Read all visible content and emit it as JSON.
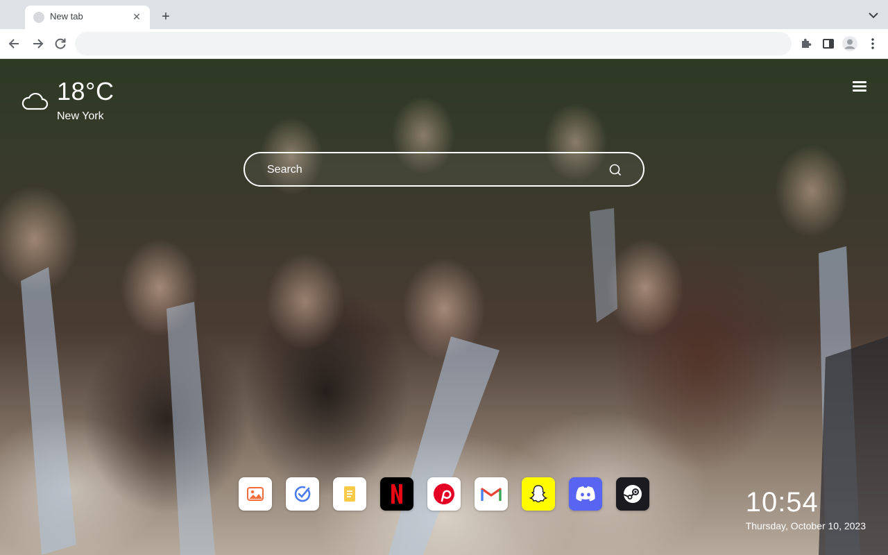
{
  "tab": {
    "title": "New tab"
  },
  "toolbar": {
    "omnibox_value": "",
    "omnibox_placeholder": ""
  },
  "weather": {
    "temperature": "18°C",
    "city": "New York",
    "icon": "cloud-icon"
  },
  "search": {
    "placeholder": "Search"
  },
  "apps": [
    {
      "name": "gallery",
      "icon": "gallery-icon",
      "bg": "#ffffff"
    },
    {
      "name": "todo",
      "icon": "checkmark-icon",
      "bg": "#ffffff"
    },
    {
      "name": "notes",
      "icon": "notes-icon",
      "bg": "#ffffff"
    },
    {
      "name": "netflix",
      "icon": "netflix-icon",
      "bg": "#000000"
    },
    {
      "name": "pinterest",
      "icon": "pinterest-icon",
      "bg": "#ffffff"
    },
    {
      "name": "gmail",
      "icon": "gmail-icon",
      "bg": "#ffffff"
    },
    {
      "name": "snapchat",
      "icon": "snapchat-icon",
      "bg": "#fffc00"
    },
    {
      "name": "discord",
      "icon": "discord-icon",
      "bg": "#5865f2"
    },
    {
      "name": "steam",
      "icon": "steam-icon",
      "bg": "#1b1b1f"
    }
  ],
  "clock": {
    "time": "10:54",
    "date": "Thursday, October 10, 2023"
  }
}
